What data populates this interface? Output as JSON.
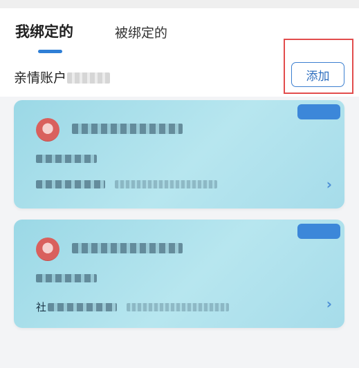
{
  "tabs": {
    "bound_by_me": "我绑定的",
    "bound_to_me": "被绑定的"
  },
  "section": {
    "title": "亲情账户",
    "add_label": "添加"
  },
  "cards": [
    {
      "badge": "",
      "prefix": "",
      "sync": ""
    },
    {
      "badge": "",
      "prefix": "社",
      "sync": ""
    }
  ],
  "colors": {
    "accent": "#2f7fd6",
    "highlight_frame": "#e24c4c",
    "card_bg": "#b7e6ef"
  }
}
